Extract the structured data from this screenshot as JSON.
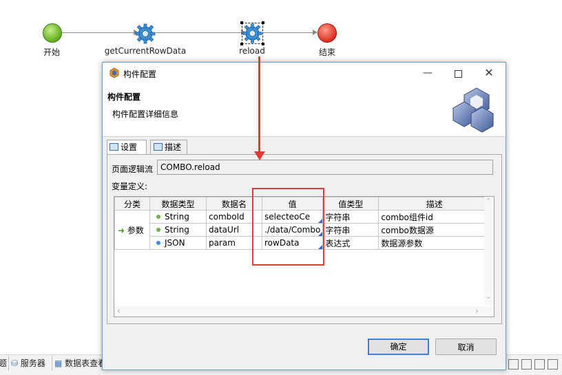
{
  "flow": {
    "start_label": "开始",
    "step1_label": "getCurrentRowData",
    "step2_label": "reload",
    "end_label": "结束"
  },
  "bottom_bar": {
    "tab_partial": "题",
    "servers_tab": "服务器",
    "db_tab": "数据表查看"
  },
  "dialog": {
    "window_title": "构件配置",
    "header_title": "构件配置",
    "header_desc": "构件配置详细信息",
    "tabs": [
      {
        "label": "设置"
      },
      {
        "label": "描述"
      }
    ],
    "page_logic_label": "页面逻辑流",
    "page_logic_value": "COMBO.reload",
    "var_def_label": "变量定义:",
    "table": {
      "headers": [
        "分类",
        "数据类型",
        "数据名",
        "值",
        "值类型",
        "描述"
      ],
      "group_label": "参数",
      "rows": [
        {
          "type": "String",
          "name": "comboId",
          "value": "selecteoCe",
          "value_type": "字符串",
          "desc": "combo组件id"
        },
        {
          "type": "String",
          "name": "dataUrl",
          "value": "./data/Combo",
          "value_type": "字符串",
          "desc": "combo数据源"
        },
        {
          "type": "JSON",
          "name": "param",
          "value": "rowData",
          "value_type": "表达式",
          "desc": "数据源参数"
        }
      ]
    },
    "ok_label": "确定",
    "cancel_label": "取消"
  },
  "colors": {
    "start_node": "#7ac143",
    "end_node": "#e8412c",
    "annotation_red": "#e53935",
    "accent_blue": "#3c7fd1"
  }
}
